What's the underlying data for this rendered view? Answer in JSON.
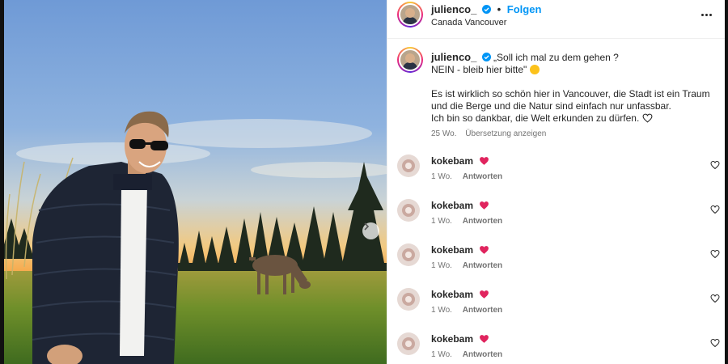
{
  "post": {
    "username": "julienco_",
    "follow_label": "Folgen",
    "separator": "•",
    "location": "Canada Vancouver",
    "caption_line1": "„Soll ich mal zu dem gehen ?",
    "caption_line2": "NEIN - bleib hier bitte\"",
    "caption_para1": "Es ist wirklich so schön hier in Vancouver, die Stadt ist ein Traum und die Berge und die Natur sind einfach nur unfassbar.",
    "caption_para2": "Ich bin so dankbar, die Welt erkunden zu dürfen.",
    "caption_age": "25 Wo.",
    "translate_label": "Übersetzung anzeigen"
  },
  "comments": [
    {
      "username": "kokebam",
      "age": "1 Wo.",
      "reply": "Antworten"
    },
    {
      "username": "kokebam",
      "age": "1 Wo.",
      "reply": "Antworten"
    },
    {
      "username": "kokebam",
      "age": "1 Wo.",
      "reply": "Antworten"
    },
    {
      "username": "kokebam",
      "age": "1 Wo.",
      "reply": "Antworten"
    },
    {
      "username": "kokebam",
      "age": "1 Wo.",
      "reply": "Antworten"
    }
  ],
  "icons": {
    "verified": "verified-badge-icon",
    "more": "more-options-icon",
    "next": "chevron-right-icon",
    "heart": "heart-icon",
    "emoji": "grinning-sweat-emoji"
  },
  "colors": {
    "accent": "#0095f6",
    "heart_red": "#e0245e",
    "muted_text": "#737373"
  }
}
